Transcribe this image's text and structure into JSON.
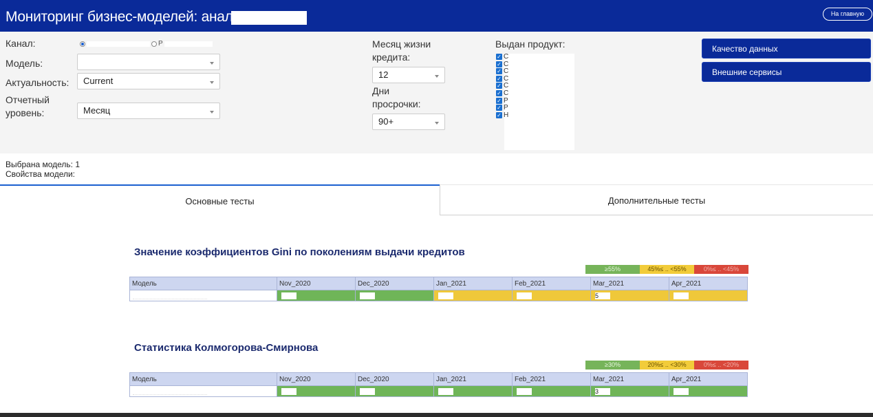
{
  "header": {
    "title": "Мониторинг бизнес-моделей: анализ",
    "home_button": "На главную"
  },
  "filters": {
    "channel_label": "Канал:",
    "model_label": "Модель:",
    "model_value": "",
    "actuality_label": "Актуальность:",
    "actuality_value": "Current",
    "report_level_label_1": "Отчетный",
    "report_level_label_2": "уровень:",
    "report_level_value": "Месяц",
    "credit_month_label_1": "Месяц жизни",
    "credit_month_label_2": "кредита:",
    "credit_month_value": "12",
    "dpd_label_1": "Дни",
    "dpd_label_2": "просрочки:",
    "dpd_value": "90+",
    "product_label": "Выдан продукт:",
    "products": [
      "С",
      "С",
      "С",
      "С",
      "С",
      "С",
      "Р",
      "Р",
      "Н"
    ]
  },
  "side_buttons": {
    "data_quality": "Качество данных",
    "external_services": "Внешние сервисы"
  },
  "model_info": {
    "selected_label": "Выбрана модель:",
    "selected_value": "1",
    "properties_label": "Свойства модели:"
  },
  "tabs": {
    "main": "Основные тесты",
    "extra": "Дополнительные тесты"
  },
  "gini": {
    "title": "Значение коэффициентов Gini по поколениям выдачи кредитов",
    "legend": [
      "≥55%",
      "45%≤ .. <55%",
      "0%≤ .. <45%"
    ],
    "columns": [
      "Модель",
      "Nov_2020",
      "Dec_2020",
      "Jan_2021",
      "Feb_2021",
      "Mar_2021",
      "Apr_2021"
    ],
    "row_colors": [
      "w",
      "g",
      "g",
      "y",
      "y",
      "y",
      "y"
    ],
    "row_values": [
      "",
      "",
      "",
      "",
      "",
      "5",
      ""
    ]
  },
  "ks": {
    "title": "Статистика Колмогорова-Смирнова",
    "legend": [
      "≥30%",
      "20%≤ .. <30%",
      "0%≤ .. <20%"
    ],
    "columns": [
      "Модель",
      "Nov_2020",
      "Dec_2020",
      "Jan_2021",
      "Feb_2021",
      "Mar_2021",
      "Apr_2021"
    ],
    "row_colors": [
      "w",
      "g",
      "g",
      "g",
      "g",
      "g",
      "g"
    ],
    "row_values": [
      "",
      "",
      "",
      "",
      "",
      "3",
      ""
    ]
  },
  "colors": {
    "header_bg": "#0a2a99",
    "green": "#6fb558",
    "yellow": "#efc83a",
    "red": "#d9473a",
    "table_header": "#cdd6f0"
  }
}
